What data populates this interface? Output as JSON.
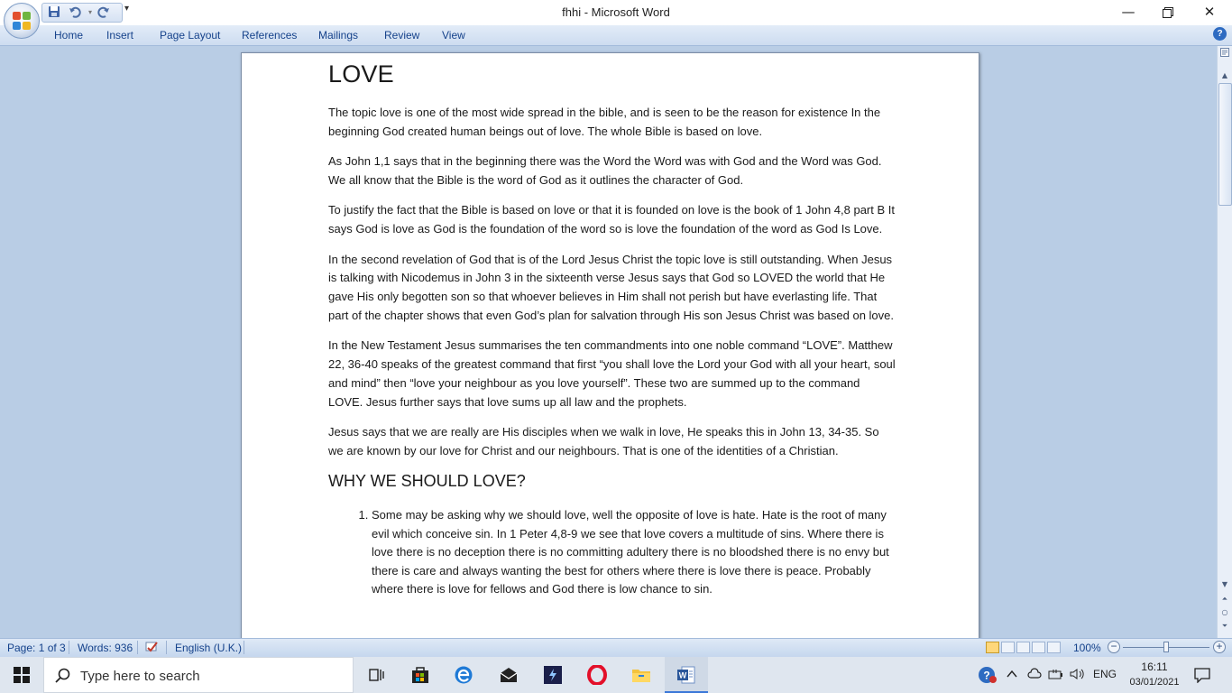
{
  "window": {
    "title": "fhhi - Microsoft Word",
    "minimize": "—",
    "restore": "❐",
    "close": "✕"
  },
  "qat": {
    "save_icon": "save-icon",
    "undo_icon": "undo-icon",
    "redo_icon": "redo-icon",
    "more": "▾"
  },
  "ribbon": {
    "tabs": [
      "Home",
      "Insert",
      "Page Layout",
      "References",
      "Mailings",
      "Review",
      "View"
    ],
    "help": "?"
  },
  "document": {
    "heading": "LOVE",
    "paragraphs": [
      "The topic love is one of the most wide spread in the bible, and is seen to be the reason for existence In the beginning God created human beings out of love. The whole Bible is based on love.",
      "As John 1,1 says that in the beginning there was the Word the Word was with God and the Word was God. We all know that the Bible is the word of God as it outlines the character of God.",
      "To justify the fact that the Bible is based on love or that it is founded on love is the book of 1 John 4,8 part B It says God is love as God is the foundation of the word so is love the foundation of the word as God Is Love.",
      "In the second revelation of God that is of the Lord Jesus Christ the topic love is still outstanding. When Jesus is talking with Nicodemus in John 3 in the sixteenth verse Jesus says that God so LOVED the world that He gave His only begotten son so that whoever believes in Him shall not perish but have everlasting life. That part of the chapter shows that even God’s plan for salvation through His son Jesus Christ was based on love.",
      "In the New Testament Jesus summarises the ten commandments into one noble command “LOVE”. Matthew 22, 36-40 speaks of the greatest command that first “you shall love the Lord your God with all your heart, soul and mind” then “love your neighbour as you love yourself”. These two are summed up to the command LOVE. Jesus further says that love sums up all law and the prophets.",
      "Jesus says that we are really are His disciples when we walk in love, He speaks this in John 13, 34-35. So we are known by our love for Christ and our neighbours. That is one of the identities of a Christian."
    ],
    "subheading": "WHY WE SHOULD LOVE?",
    "list_items": [
      "Some may be asking why we should love, well the opposite of love is hate. Hate is the root of many evil which conceive sin. In 1 Peter 4,8-9 we see that love covers a multitude of sins. Where there is love there is no deception there is no committing adultery there is no bloodshed there is no envy but there is care and always wanting the best for others where there is love there is peace. Probably where there is love for fellows and God there is low chance to sin."
    ]
  },
  "statusbar": {
    "page": "Page: 1 of 3",
    "words": "Words: 936",
    "language": "English (U.K.)",
    "zoom": "100%",
    "zoom_level_percent": 100
  },
  "taskbar": {
    "search_placeholder": "Type here to search",
    "apps": [
      "task-view",
      "microsoft-store",
      "edge",
      "mail",
      "pycharm-like",
      "opera",
      "file-explorer",
      "word"
    ],
    "language": "ENG",
    "time": "16:11",
    "date": "03/01/2021"
  }
}
